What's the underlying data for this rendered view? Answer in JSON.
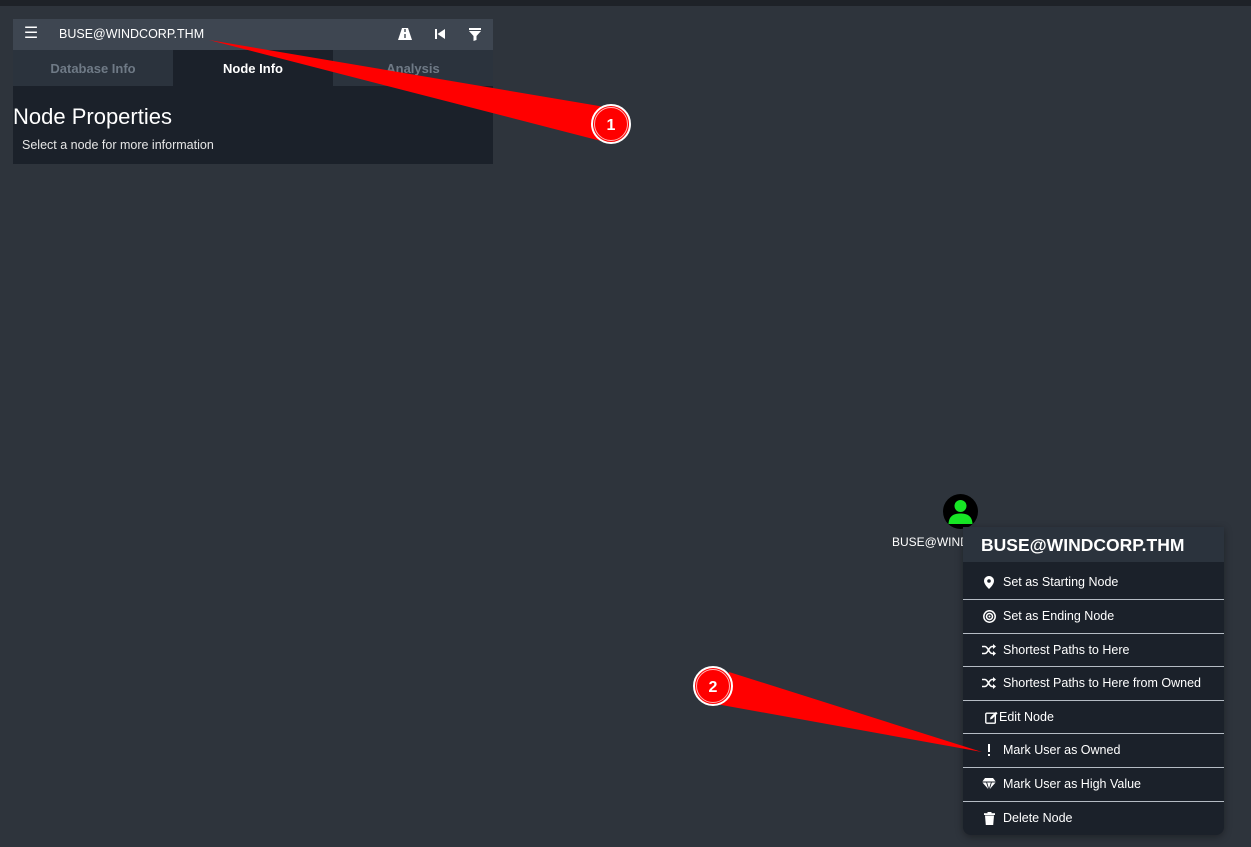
{
  "panel": {
    "search_value": "BUSE@WINDCORP.THM",
    "tabs": [
      {
        "label": "Database Info",
        "active": false
      },
      {
        "label": "Node Info",
        "active": true
      },
      {
        "label": "Analysis",
        "active": false
      }
    ],
    "node_properties_title": "Node Properties",
    "node_properties_hint": "Select a node for more information",
    "icons": [
      "menu-icon",
      "pathfinding-road-icon",
      "step-back-icon",
      "filter-icon"
    ]
  },
  "node": {
    "label": "BUSE@WIND",
    "icon": "user-icon",
    "icon_color": "#17e625"
  },
  "context_menu": {
    "title": "BUSE@WINDCORP.THM",
    "items": [
      {
        "label": "Set as Starting Node",
        "icon": "map-marker-icon"
      },
      {
        "label": "Set as Ending Node",
        "icon": "target-icon"
      },
      {
        "label": "Shortest Paths to Here",
        "icon": "shuffle-icon"
      },
      {
        "label": "Shortest Paths to Here from Owned",
        "icon": "shuffle-icon"
      },
      {
        "label": "Edit Node",
        "icon": "edit-icon"
      },
      {
        "label": "Mark User as Owned",
        "icon": "exclamation-icon"
      },
      {
        "label": "Mark User as High Value",
        "icon": "gem-icon"
      },
      {
        "label": "Delete Node",
        "icon": "trash-icon"
      }
    ]
  },
  "annotations": {
    "color": "#ff0000",
    "badges": [
      "1",
      "2"
    ]
  },
  "colors": {
    "background": "#2e343c",
    "panel": "#1b212a",
    "search_bar": "#3e4651",
    "tab_inactive": "#2b333d"
  }
}
